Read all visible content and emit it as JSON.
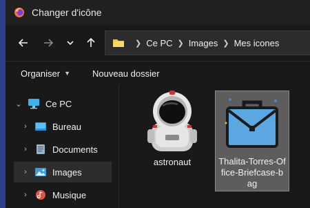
{
  "window": {
    "title": "Changer d'icône"
  },
  "nav": {
    "back_icon": "arrow-left-icon",
    "forward_icon": "arrow-right-icon",
    "history_icon": "chevron-down-icon",
    "up_icon": "arrow-up-icon"
  },
  "address": {
    "crumbs": [
      "Ce PC",
      "Images",
      "Mes icones"
    ]
  },
  "toolbar": {
    "organize_label": "Organiser",
    "new_folder_label": "Nouveau dossier"
  },
  "sidebar": {
    "items": [
      {
        "label": "Ce PC",
        "icon": "computer-icon",
        "level": 0,
        "expanded": true
      },
      {
        "label": "Bureau",
        "icon": "desktop-folder-icon",
        "level": 1
      },
      {
        "label": "Documents",
        "icon": "documents-icon",
        "level": 1
      },
      {
        "label": "Images",
        "icon": "pictures-icon",
        "level": 1,
        "selected": true
      },
      {
        "label": "Musique",
        "icon": "music-icon",
        "level": 1
      }
    ]
  },
  "files": [
    {
      "name": "astronaut",
      "icon": "astronaut-icon",
      "selected": false
    },
    {
      "name_lines": [
        "Thalita-Torres-Of",
        "fice-Briefcase-b",
        "ag"
      ],
      "icon": "briefcase-icon",
      "selected": true
    }
  ],
  "colors": {
    "window_bg": "#191919",
    "titlebar_bg": "#202020",
    "selection_bg": "#5d5d5d",
    "folder_yellow": "#f3c43c",
    "briefcase_blue": "#5aa7e2"
  }
}
